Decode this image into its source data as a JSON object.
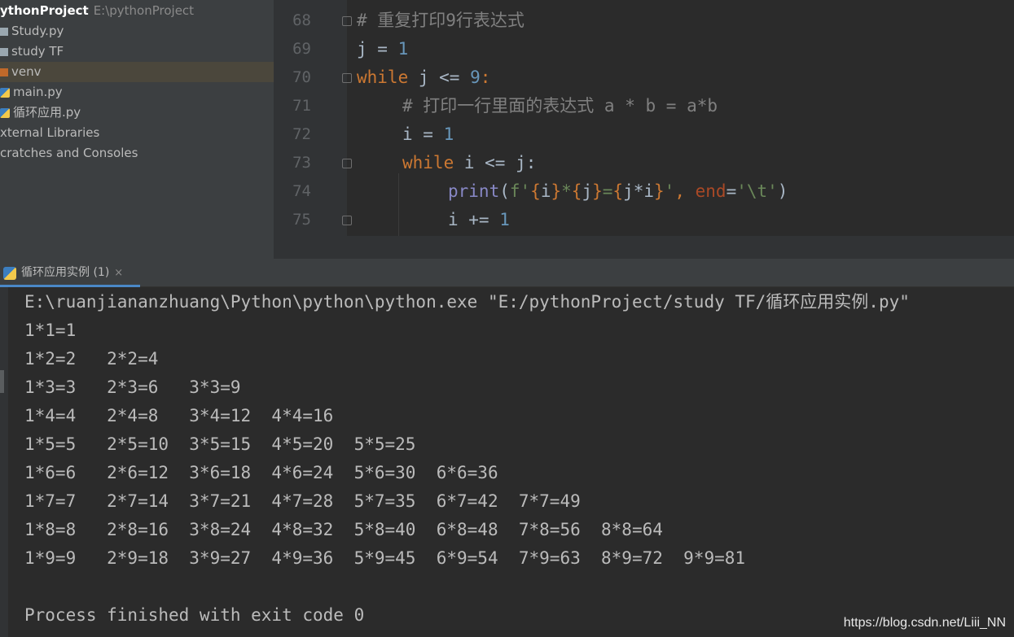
{
  "project_tree": {
    "project_name": "ythonProject",
    "project_path": "E:\\pythonProject",
    "items": [
      {
        "label": "Study.py",
        "icon": "folder-icon"
      },
      {
        "label": "study TF",
        "icon": "folder-icon"
      },
      {
        "label": "venv",
        "icon": "excluded-folder-icon",
        "selected": true
      },
      {
        "label": "main.py",
        "icon": "python-file-icon"
      },
      {
        "label": "循环应用.py",
        "icon": "python-file-icon"
      },
      {
        "label": "xternal Libraries",
        "icon": ""
      },
      {
        "label": "cratches and Consoles",
        "icon": ""
      }
    ]
  },
  "editor": {
    "line_numbers": [
      "68",
      "69",
      "70",
      "71",
      "72",
      "73",
      "74",
      "75"
    ],
    "code": {
      "l68_comment": "# 重复打印9行表达式",
      "l69_var": "j = ",
      "l69_num": "1",
      "l70_kw": "while",
      "l70_cond": " j <= ",
      "l70_num": "9",
      "l70_colon": ":",
      "l71_comment": "# 打印一行里面的表达式 a * b = a*b",
      "l72_var": "i = ",
      "l72_num": "1",
      "l73_kw": "while",
      "l73_cond": " i <= j:",
      "l74_fn": "print",
      "l74_open": "(",
      "l74_fstr_prefix": "f'",
      "l74_b1": "{",
      "l74_v1": "i",
      "l74_b2": "}",
      "l74_star": "*",
      "l74_b3": "{",
      "l74_v2": "j",
      "l74_b4": "}",
      "l74_eq": "=",
      "l74_b5": "{",
      "l74_v3": "j*i",
      "l74_b6": "}",
      "l74_quote": "'",
      "l74_comma": ", ",
      "l74_kwarg": "end",
      "l74_assign": "=",
      "l74_endstr": "'\\t'",
      "l74_close": ")",
      "l75_var": "i += ",
      "l75_num": "1"
    }
  },
  "run_panel": {
    "tab_label": "循环应用实例 (1)",
    "close_glyph": "×"
  },
  "console": {
    "lines": [
      "E:\\ruanjiananzhuang\\Python\\python\\python.exe \"E:/pythonProject/study TF/循环应用实例.py\"",
      "1*1=1",
      "1*2=2   2*2=4",
      "1*3=3   2*3=6   3*3=9",
      "1*4=4   2*4=8   3*4=12  4*4=16",
      "1*5=5   2*5=10  3*5=15  4*5=20  5*5=25",
      "1*6=6   2*6=12  3*6=18  4*6=24  5*6=30  6*6=36",
      "1*7=7   2*7=14  3*7=21  4*7=28  5*7=35  6*7=42  7*7=49",
      "1*8=8   2*8=16  3*8=24  4*8=32  5*8=40  6*8=48  7*8=56  8*8=64",
      "1*9=9   2*9=18  3*9=27  4*9=36  5*9=45  6*9=54  7*9=63  8*9=72  9*9=81",
      "",
      "Process finished with exit code 0"
    ]
  },
  "watermark": "https://blog.csdn.net/Liii_NN",
  "colors": {
    "keyword": "#cc7832",
    "number": "#6897bb",
    "comment": "#808080",
    "builtin": "#8888c6",
    "string": "#6a8759",
    "kwarg": "#aa4926",
    "background": "#2b2b2b"
  }
}
